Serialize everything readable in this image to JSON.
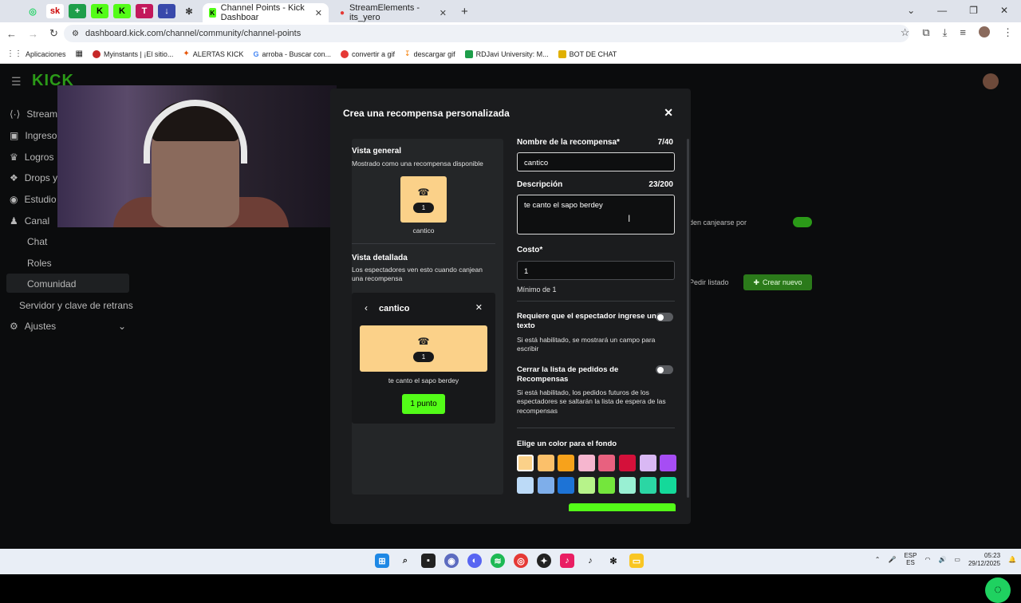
{
  "browser": {
    "tabs": [
      {
        "title": "Channel Points - Kick Dashboar",
        "active": true
      },
      {
        "title": "StreamElements - its_yero",
        "active": false
      }
    ],
    "url": "dashboard.kick.com/channel/community/channel-points",
    "bookmarks": [
      "Aplicaciones",
      "Myinstants | ¡El sitio...",
      "ALERTAS KICK",
      "arroba - Buscar con...",
      "convertir a gif",
      "descargar gif",
      "RDJavi University: M...",
      "BOT DE CHAT"
    ]
  },
  "sidebar": {
    "logo": "KICK",
    "items": [
      "Stream",
      "Ingreso",
      "Logros",
      "Drops y",
      "Estudio",
      "Canal"
    ],
    "sub_items": [
      "Chat",
      "Roles",
      "Comunidad",
      "Servidor y clave de retrans"
    ],
    "settings": "Ajustes"
  },
  "background": {
    "toggle_text": "den canjearse por",
    "pedir_listado": "Pedir listado",
    "crear_nuevo": "Crear nuevo"
  },
  "modal": {
    "title": "Crea una recompensa personalizada",
    "preview": {
      "general_title": "Vista general",
      "general_sub": "Mostrado como una recompensa disponible",
      "card_cost": "1",
      "card_name": "cantico",
      "detail_title": "Vista detallada",
      "detail_sub": "Los espectadores ven esto cuando canjean una recompensa",
      "detail_name": "cantico",
      "detail_cost": "1",
      "detail_desc": "te canto el sapo berdey",
      "point_button": "1 punto"
    },
    "form": {
      "name_label": "Nombre de la recompensa*",
      "name_count": "7/40",
      "name_value": "cantico",
      "desc_label": "Descripción",
      "desc_count": "23/200",
      "desc_value": "te canto el sapo berdey",
      "cost_label": "Costo*",
      "cost_value": "1",
      "cost_min": "Mínimo de 1",
      "req_text_label": "Requiere que el espectador ingrese un texto",
      "req_text_sub": "Si está habilitado, se mostrará un campo para escribir",
      "close_list_label": "Cerrar la lista de pedidos de Recompensas",
      "close_list_sub": "Si está habilitado, los pedidos futuros de los espectadores se saltarán la lista de espera de las recompensas",
      "color_label": "Elige un color para el fondo",
      "colors": [
        "#fbd189",
        "#fbc06a",
        "#f7a21b",
        "#f6b6cf",
        "#e8617f",
        "#d4103a",
        "#d9b8f4",
        "#a64df4",
        "#bcdaf7",
        "#7eaeea",
        "#1d73d6",
        "#b7f38a",
        "#74e63c",
        "#99f0d3",
        "#2bd6a4",
        "#14d99a"
      ]
    }
  },
  "taskbar": {
    "lang": "ESP",
    "lang2": "ES",
    "time": "05:23",
    "date": "29/12/2025"
  }
}
